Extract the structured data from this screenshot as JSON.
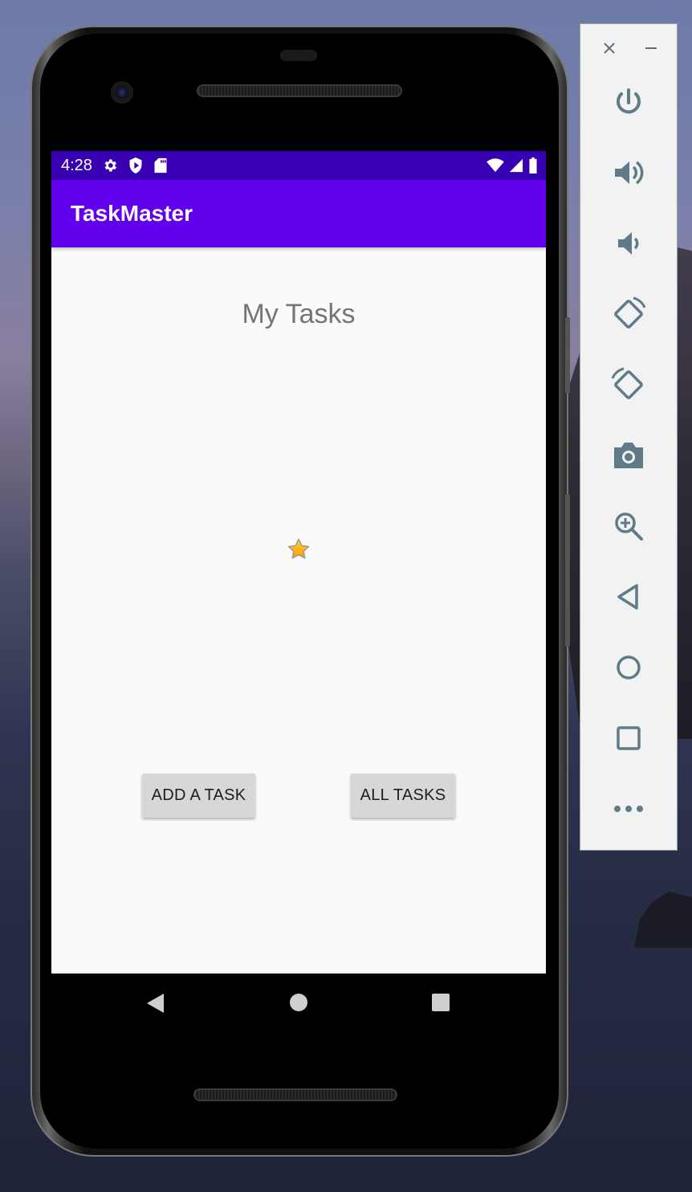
{
  "status_bar": {
    "time": "4:28",
    "icons": [
      "gear-icon",
      "shield-icon",
      "sd-card-icon",
      "wifi-icon",
      "cellular-icon",
      "battery-icon"
    ]
  },
  "app_bar": {
    "title": "TaskMaster"
  },
  "main": {
    "heading": "My Tasks",
    "center_icon": "star-icon",
    "buttons": {
      "add_task": "ADD A TASK",
      "all_tasks": "ALL TASKS"
    }
  },
  "nav_bar": {
    "icons": [
      "back-icon",
      "home-icon",
      "recents-icon"
    ]
  },
  "emulator_panel": {
    "window_controls": [
      "close-icon",
      "minimize-icon"
    ],
    "tools": [
      "power-icon",
      "volume-up-icon",
      "volume-down-icon",
      "rotate-left-icon",
      "rotate-right-icon",
      "camera-icon",
      "zoom-icon",
      "back-icon",
      "home-icon",
      "overview-icon",
      "more-icon"
    ]
  },
  "colors": {
    "status_bar": "#3700b3",
    "app_bar": "#6200ee",
    "screen_bg": "#fafafa",
    "button_bg": "#d6d7d7",
    "heading_text": "#757575",
    "panel_icon": "#5f7b8a"
  }
}
